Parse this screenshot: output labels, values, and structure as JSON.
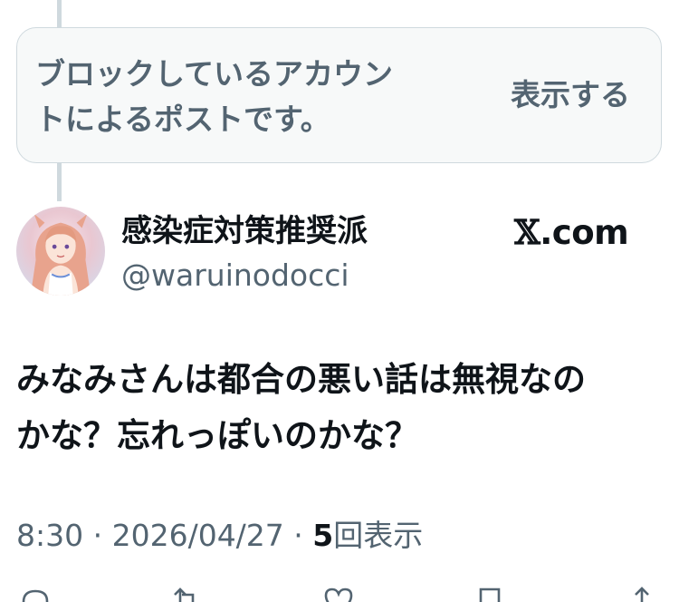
{
  "blocked_notice": {
    "message_lines": [
      "ブロックしているアカウン",
      "トによるポストです。"
    ],
    "show_button": "表示する"
  },
  "post": {
    "author": {
      "display_name": "感染症対策推奨派",
      "handle": "@waruinodocci"
    },
    "brand": {
      "mark": "𝕏",
      "domain": ".com"
    },
    "text_lines": [
      "みなみさんは都合の悪い話は無視なの",
      "かな？忘れっぽいのかな？"
    ],
    "meta": {
      "time": "8:30",
      "separator": " · ",
      "date": "2026/04/27",
      "views_count": "5",
      "views_label": "回表示"
    },
    "actions": [
      "reply-icon",
      "repost-icon",
      "like-icon",
      "bookmark-icon",
      "share-icon"
    ]
  },
  "colors": {
    "text_primary": "#0f1419",
    "text_secondary": "#536471",
    "border": "#cfd9de",
    "box_bg": "#f7f9f9"
  }
}
